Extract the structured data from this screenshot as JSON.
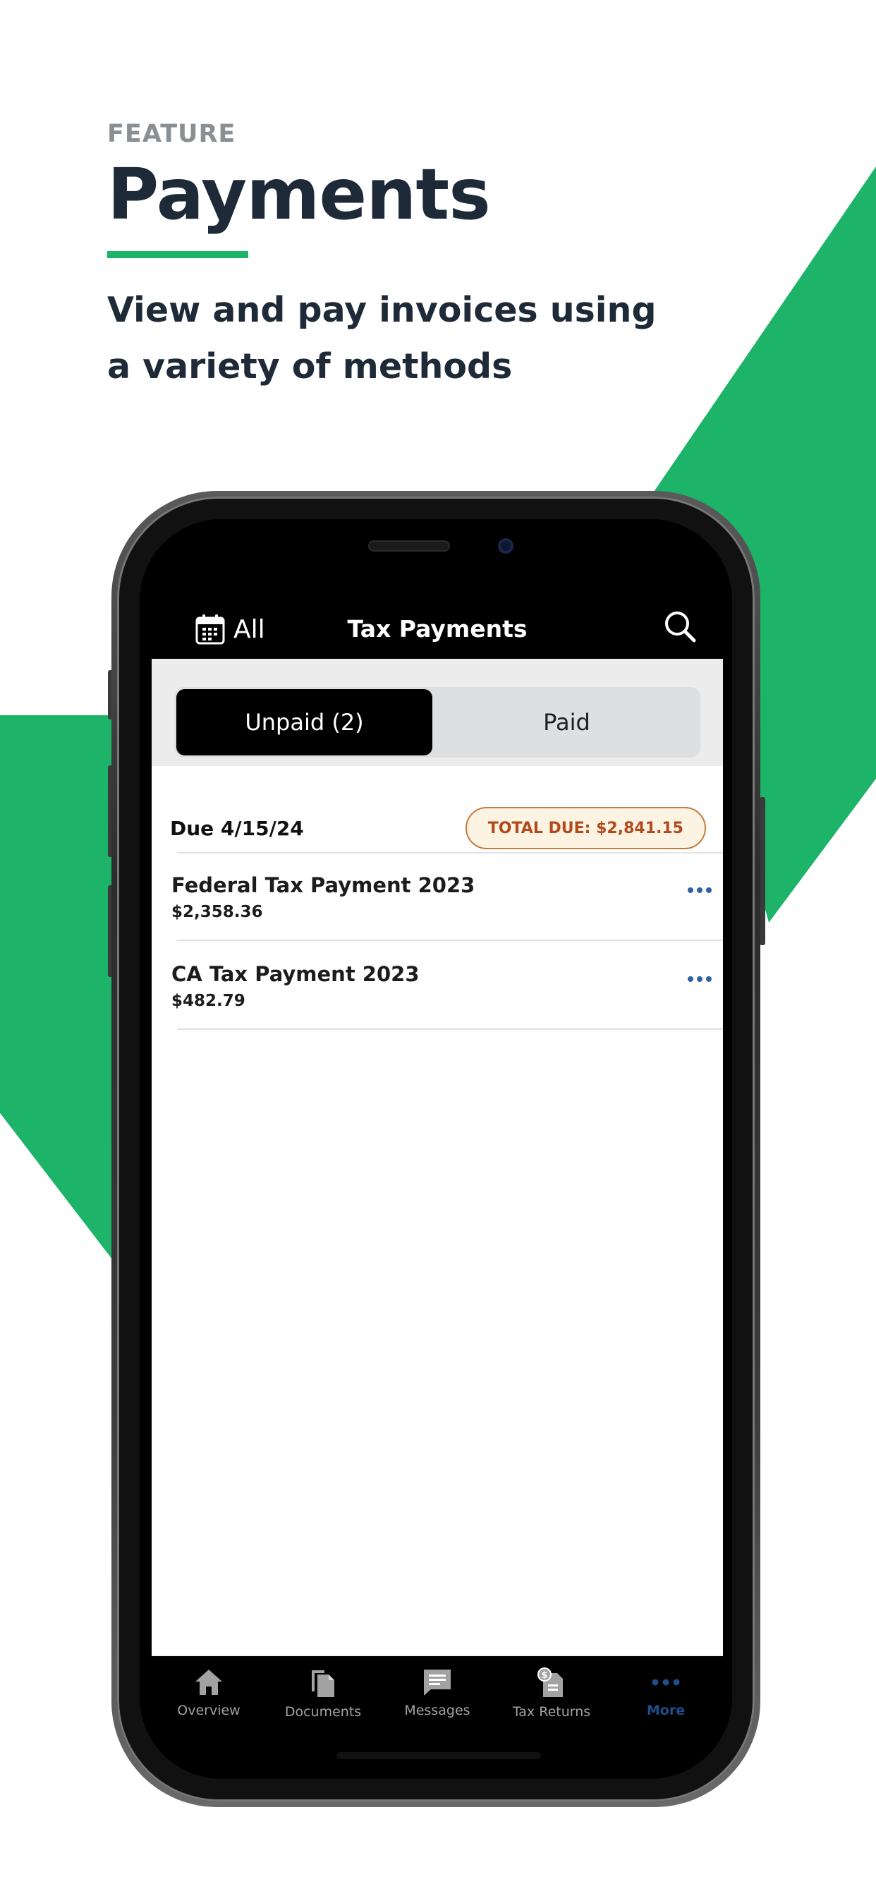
{
  "promo": {
    "eyebrow": "FEATURE",
    "title": "Payments",
    "subtitle": "View and pay invoices using a variety of methods",
    "accent_color": "#1db46a",
    "text_color": "#1e2a38"
  },
  "app": {
    "header": {
      "filter_label": "All",
      "filter_icon": "calendar-icon",
      "title": "Tax Payments",
      "search_icon": "search-icon"
    },
    "segments": {
      "unpaid": "Unpaid (2)",
      "paid": "Paid",
      "selected": "unpaid"
    },
    "due_group": {
      "due_label": "Due 4/15/24",
      "total_badge": "TOTAL DUE: $2,841.15"
    },
    "payments": [
      {
        "name": "Federal Tax Payment 2023",
        "amount": "$2,358.36",
        "menu_icon": "more-icon"
      },
      {
        "name": "CA Tax Payment 2023",
        "amount": "$482.79",
        "menu_icon": "more-icon"
      }
    ],
    "tabs": [
      {
        "label": "Overview",
        "icon": "home-icon",
        "active": false
      },
      {
        "label": "Documents",
        "icon": "documents-icon",
        "active": false
      },
      {
        "label": "Messages",
        "icon": "message-icon",
        "active": false
      },
      {
        "label": "Tax Returns",
        "icon": "tax-returns-icon",
        "active": false
      },
      {
        "label": "More",
        "icon": "more-icon",
        "active": true
      }
    ],
    "colors": {
      "link_blue": "#2c62a6",
      "active_tab": "#1f4e8c",
      "badge_text": "#b14a1c",
      "badge_border": "#c77a3a"
    }
  }
}
